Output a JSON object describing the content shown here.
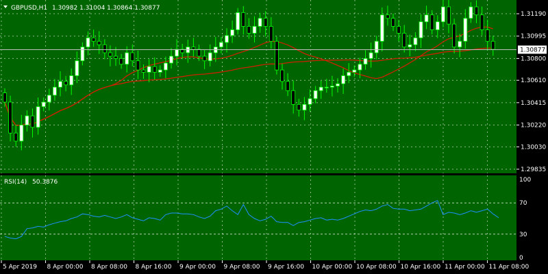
{
  "header": {
    "symbol_label": "GBPUSD,H1",
    "ohlc": "1.30982 1.31004 1.30864 1.30877"
  },
  "rsi_header": {
    "label": "RSI(14)",
    "value": "50.3876"
  },
  "colors": {
    "background": "#006400",
    "grid": "#ffffff",
    "bull_candle": "#ffffff",
    "bear_candle": "#000000",
    "wick": "#00ff00",
    "ma": "#cc2200",
    "rsi_line": "#1e90ff",
    "text": "#ffffff",
    "price_tag_bg": "#ffffff",
    "price_tag_text": "#000000"
  },
  "chart_data": [
    {
      "type": "candlestick",
      "title": "GBPUSD,H1",
      "x_ticks": [
        "5 Apr 2019",
        "8 Apr 00:00",
        "8 Apr 08:00",
        "8 Apr 16:00",
        "9 Apr 00:00",
        "9 Apr 08:00",
        "9 Apr 16:00",
        "10 Apr 00:00",
        "10 Apr 08:00",
        "10 Apr 16:00",
        "11 Apr 00:00",
        "11 Apr 08:00"
      ],
      "y_ticks": [
        "1.31190",
        "1.30995",
        "1.30800",
        "1.30610",
        "1.30415",
        "1.30220",
        "1.30030",
        "1.29835"
      ],
      "ylim": [
        1.29835,
        1.3125
      ],
      "current_price": "1.30877",
      "close": [
        1.3042,
        1.3015,
        1.3008,
        1.3022,
        1.303,
        1.302,
        1.3038,
        1.3042,
        1.3048,
        1.3055,
        1.306,
        1.3057,
        1.3065,
        1.3078,
        1.309,
        1.3098,
        1.3095,
        1.3092,
        1.3085,
        1.3082,
        1.308,
        1.3075,
        1.3085,
        1.3078,
        1.307,
        1.3068,
        1.3073,
        1.3068,
        1.307,
        1.3076,
        1.3082,
        1.3088,
        1.3085,
        1.309,
        1.3088,
        1.3082,
        1.3078,
        1.3085,
        1.309,
        1.3094,
        1.31,
        1.3105,
        1.312,
        1.3108,
        1.3102,
        1.3108,
        1.3115,
        1.3108,
        1.3095,
        1.307,
        1.306,
        1.3052,
        1.304,
        1.3035,
        1.304,
        1.3045,
        1.3052,
        1.3055,
        1.3055,
        1.3056,
        1.3058,
        1.3065,
        1.3068,
        1.307,
        1.3075,
        1.308,
        1.3085,
        1.3095,
        1.3118,
        1.3115,
        1.3108,
        1.3102,
        1.309,
        1.3092,
        1.3098,
        1.3112,
        1.3118,
        1.3105,
        1.3112,
        1.3125,
        1.311,
        1.309,
        1.3095,
        1.3115,
        1.3125,
        1.3118,
        1.3105,
        1.3095,
        1.3088
      ],
      "rsi": {
        "label": "RSI(14)",
        "levels": [
          70,
          30
        ],
        "ylim": [
          0,
          100
        ],
        "y_ticks": [
          "100",
          "70",
          "30",
          "0"
        ],
        "values": [
          27,
          25,
          24,
          27,
          37,
          38,
          40,
          39,
          42,
          44,
          46,
          47,
          50,
          52,
          56,
          55,
          53,
          52,
          54,
          52,
          50,
          52,
          55,
          51,
          49,
          47,
          51,
          50,
          48,
          55,
          57,
          57,
          56,
          56,
          55,
          52,
          50,
          53,
          60,
          62,
          66,
          60,
          55,
          68,
          55,
          50,
          47,
          49,
          53,
          46,
          45,
          45,
          41,
          45,
          46,
          48,
          50,
          51,
          48,
          49,
          48,
          50,
          53,
          56,
          59,
          61,
          60,
          62,
          66,
          68,
          63,
          62,
          62,
          60,
          61,
          62,
          66,
          70,
          73,
          55,
          58,
          57,
          55,
          57,
          60,
          58,
          60,
          62,
          56,
          51
        ]
      }
    }
  ]
}
